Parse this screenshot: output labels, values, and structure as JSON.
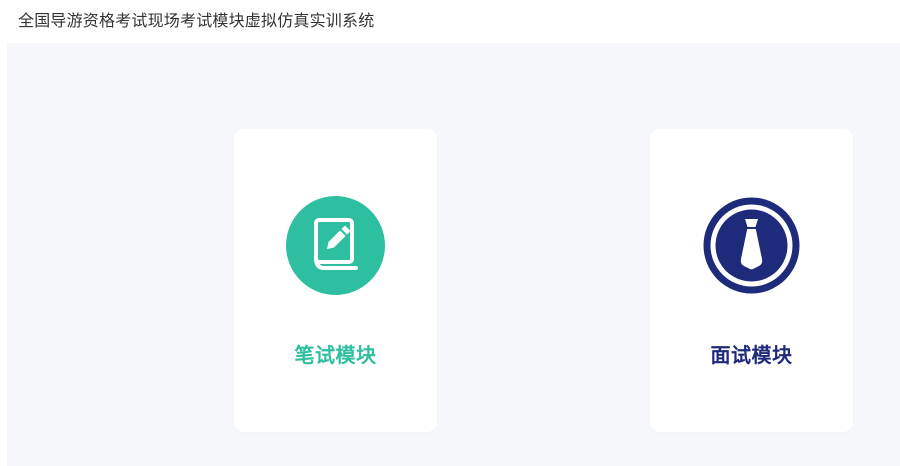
{
  "app": {
    "title": "全国导游资格考试现场考试模块虚拟仿真实训系统"
  },
  "modules": [
    {
      "label": "笔试模块",
      "icon": "notebook-pen-icon",
      "color": "#2dbf9f"
    },
    {
      "label": "面试模块",
      "icon": "necktie-icon",
      "color": "#1e2a7a"
    }
  ],
  "colors": {
    "background": "#f5f7fa",
    "card": "#ffffff",
    "written_accent": "#2dbf9f",
    "interview_accent": "#1e2a7a"
  }
}
